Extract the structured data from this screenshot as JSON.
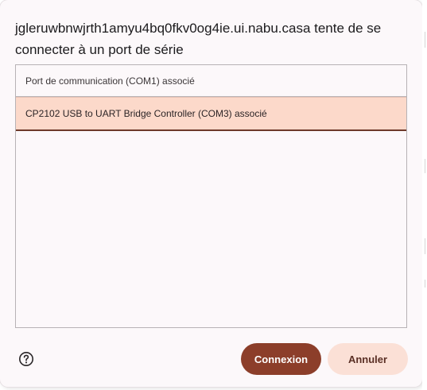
{
  "dialog": {
    "title": "jgleruwbnwjrth1amyu4bq0fkv0og4ie.ui.nabu.casa tente de se connecter à un port de série"
  },
  "ports": [
    {
      "label": "Port de communication (COM1) associé",
      "selected": false
    },
    {
      "label": "CP2102 USB to UART Bridge Controller (COM3) associé",
      "selected": true
    }
  ],
  "footer": {
    "help_icon": "help-circle-icon",
    "connect_label": "Connexion",
    "cancel_label": "Annuler"
  },
  "colors": {
    "primary": "#8c3e2a",
    "secondary": "#fbe0d6",
    "selected_row": "#fcd9ca"
  }
}
